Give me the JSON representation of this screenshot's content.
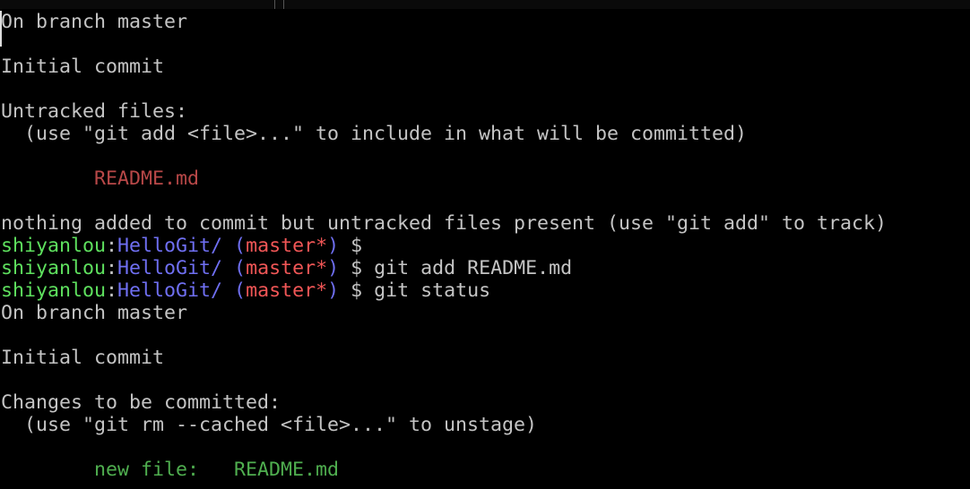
{
  "terminal": {
    "colors": {
      "default": "#c4c4c4",
      "user": "#5ee05e",
      "path": "#6f6ff2",
      "branch": "#f05656",
      "untracked": "#b84848",
      "staged": "#4fae4f"
    },
    "lines": [
      [
        {
          "t": "On branch master",
          "c": "default"
        }
      ],
      [],
      [
        {
          "t": "Initial commit",
          "c": "default"
        }
      ],
      [],
      [
        {
          "t": "Untracked files:",
          "c": "default"
        }
      ],
      [
        {
          "t": "  (use \"git add <file>...\" to include in what will be committed)",
          "c": "default"
        }
      ],
      [],
      [
        {
          "t": "        README.md",
          "c": "darkred"
        }
      ],
      [],
      [
        {
          "t": "nothing added to commit but untracked files present (use \"git add\" to track)",
          "c": "default"
        }
      ],
      [
        {
          "t": "shiyanlou",
          "c": "green"
        },
        {
          "t": ":",
          "c": "default"
        },
        {
          "t": "HelloGit/",
          "c": "blue"
        },
        {
          "t": " (",
          "c": "blue"
        },
        {
          "t": "master*",
          "c": "red"
        },
        {
          "t": ")",
          "c": "blue"
        },
        {
          "t": " $ ",
          "c": "default"
        }
      ],
      [
        {
          "t": "shiyanlou",
          "c": "green"
        },
        {
          "t": ":",
          "c": "default"
        },
        {
          "t": "HelloGit/",
          "c": "blue"
        },
        {
          "t": " (",
          "c": "blue"
        },
        {
          "t": "master*",
          "c": "red"
        },
        {
          "t": ")",
          "c": "blue"
        },
        {
          "t": " $ git add README.md",
          "c": "default"
        }
      ],
      [
        {
          "t": "shiyanlou",
          "c": "green"
        },
        {
          "t": ":",
          "c": "default"
        },
        {
          "t": "HelloGit/",
          "c": "blue"
        },
        {
          "t": " (",
          "c": "blue"
        },
        {
          "t": "master*",
          "c": "red"
        },
        {
          "t": ")",
          "c": "blue"
        },
        {
          "t": " $ git status",
          "c": "default"
        }
      ],
      [
        {
          "t": "On branch master",
          "c": "default"
        }
      ],
      [],
      [
        {
          "t": "Initial commit",
          "c": "default"
        }
      ],
      [],
      [
        {
          "t": "Changes to be committed:",
          "c": "default"
        }
      ],
      [
        {
          "t": "  (use \"git rm --cached <file>...\" to unstage)",
          "c": "default"
        }
      ],
      [],
      [
        {
          "t": "        new file:   README.md",
          "c": "dkgreen"
        }
      ]
    ]
  }
}
